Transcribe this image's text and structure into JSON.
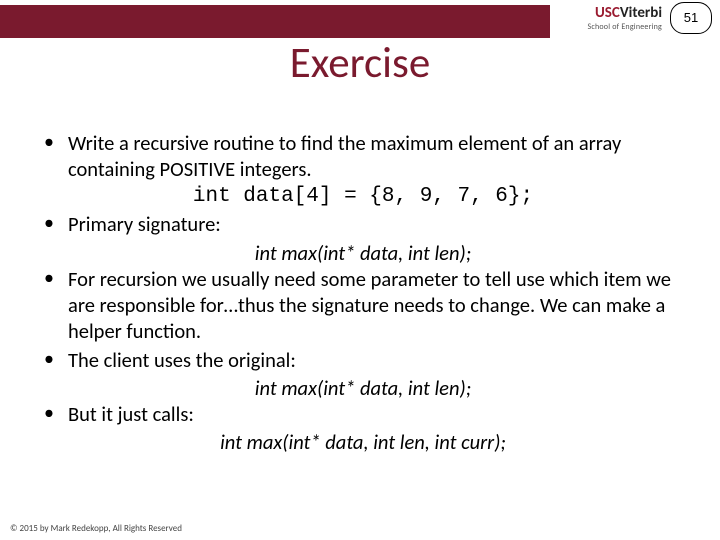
{
  "page_number": "51",
  "logo": {
    "usc": "USC",
    "viterbi": "Viterbi",
    "sub": "School of Engineering"
  },
  "title": "Exercise",
  "bullets": {
    "b1": "Write a recursive routine to find the maximum element of an array containing POSITIVE integers.",
    "code1": "int data[4] = {8, 9, 7, 6};",
    "b2": "Primary signature:",
    "sig1": "int max(int* data, int len);",
    "b3": "For recursion we usually need some parameter to tell use which item we are responsible for…thus the signature needs to change.  We can make a helper function.",
    "b4": "The client uses the original:",
    "sig2": "int max(int* data, int len);",
    "b5": "But it just calls:",
    "sig3": "int max(int* data, int len, int curr);"
  },
  "footer": "© 2015 by Mark Redekopp, All Rights Reserved"
}
